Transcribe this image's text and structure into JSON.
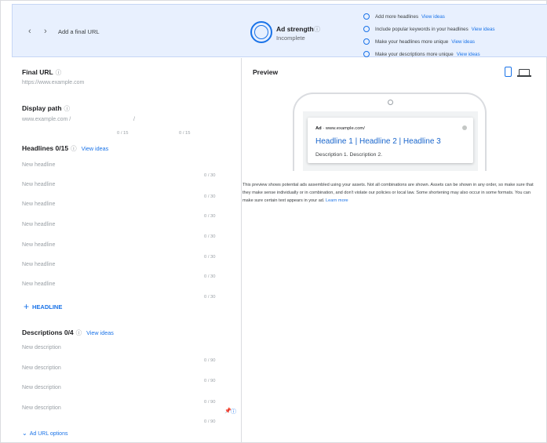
{
  "banner": {
    "prev_icon": "chevron-left-icon",
    "next_icon": "chevron-right-icon",
    "prev_glyph": "‹",
    "next_glyph": "›",
    "final_url_link": "Add a final URL",
    "ad_strength": {
      "title": "Ad strength",
      "help": "ⓘ",
      "status": "Incomplete"
    },
    "tips": [
      {
        "text": "Add more headlines",
        "link": "View ideas"
      },
      {
        "text": "Include popular keywords in your headlines",
        "link": "View ideas"
      },
      {
        "text": "Make your headlines more unique",
        "link": "View ideas"
      },
      {
        "text": "Make your descriptions more unique",
        "link": "View ideas"
      }
    ]
  },
  "form": {
    "final_url": {
      "label": "Final URL",
      "help": "ⓘ",
      "placeholder": "https://www.example.com"
    },
    "display_path": {
      "label": "Display path",
      "help": "ⓘ",
      "prefix": "www.example.com /",
      "separator": "/",
      "counter1": "0 / 15",
      "counter2": "0 / 15"
    },
    "headlines": {
      "label": "Headlines 0/15",
      "help": "ⓘ",
      "view_ideas": "View ideas",
      "placeholder": "New headline",
      "counter": "0 / 30",
      "add_button": "HEADLINE",
      "add_glyph": "+"
    },
    "descriptions": {
      "label": "Descriptions 0/4",
      "help": "ⓘ",
      "view_ideas": "View ideas",
      "placeholder": "New description",
      "counter": "0 / 90",
      "pin_glyph": "📌",
      "pin_help": "ⓘ"
    },
    "ad_url_options": "Ad URL options",
    "ad_url_chevron": "⌄"
  },
  "preview": {
    "title": "Preview",
    "ad": {
      "label": "Ad",
      "separator": "·",
      "url": "www.example.com/",
      "headline": "Headline 1 | Headline 2 | Headline 3",
      "description": "Description 1. Description 2."
    },
    "disclaimer": "This preview shows potential ads assembled using your assets. Not all combinations are shown. Assets can be shown in any order, so make sure that they make sense individually or in combination, and don't violate our policies or local law. Some shortening may also occur in some formats. You can make sure certain text appears in your ad.",
    "learn_more": "Learn more"
  },
  "colors": {
    "accent": "#1a73e8",
    "banner_bg": "#e8f0fe",
    "headline_link": "#1a66cc"
  }
}
